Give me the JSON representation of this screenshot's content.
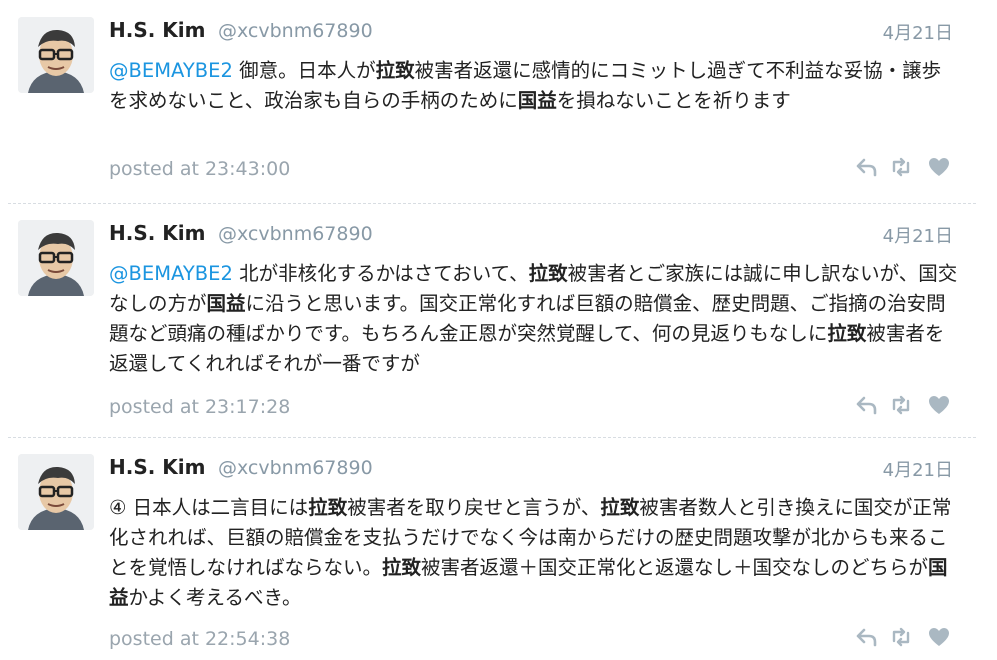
{
  "tweets": [
    {
      "name": "H.S. Kim",
      "handle": "@xcvbnm67890",
      "date": "4月21日",
      "segments": [
        {
          "t": "@BEMAYBE2",
          "s": "mention"
        },
        {
          "t": " 御意。日本人が",
          "s": ""
        },
        {
          "t": "拉致",
          "s": "bold"
        },
        {
          "t": "被害者返還に感情的にコミットし過ぎて不利益な妥協・譲歩を求めないこと、政治家も自らの手柄のために",
          "s": ""
        },
        {
          "t": "国益",
          "s": "bold"
        },
        {
          "t": "を損ねないことを祈ります",
          "s": ""
        }
      ],
      "posted": "posted at 23:43:00"
    },
    {
      "name": "H.S. Kim",
      "handle": "@xcvbnm67890",
      "date": "4月21日",
      "segments": [
        {
          "t": "@BEMAYBE2",
          "s": "mention"
        },
        {
          "t": " 北が非核化するかはさておいて、",
          "s": ""
        },
        {
          "t": "拉致",
          "s": "bold"
        },
        {
          "t": "被害者とご家族には誠に申し訳ないが、国交なしの方が",
          "s": ""
        },
        {
          "t": "国益",
          "s": "bold"
        },
        {
          "t": "に沿うと思います。国交正常化すれば巨額の賠償金、歴史問題、ご指摘の治安問題など頭痛の種ばかりです。もちろん金正恩が突然覚醒して、何の見返りもなしに",
          "s": ""
        },
        {
          "t": "拉致",
          "s": "bold"
        },
        {
          "t": "被害者を返還してくれればそれが一番ですが",
          "s": ""
        }
      ],
      "posted": "posted at 23:17:28"
    },
    {
      "name": "H.S. Kim",
      "handle": "@xcvbnm67890",
      "date": "4月21日",
      "segments": [
        {
          "t": "④ 日本人は二言目には",
          "s": ""
        },
        {
          "t": "拉致",
          "s": "bold"
        },
        {
          "t": "被害者を取り戻せと言うが、",
          "s": ""
        },
        {
          "t": "拉致",
          "s": "bold"
        },
        {
          "t": "被害者数人と引き換えに国交が正常化されれば、巨額の賠償金を支払うだけでなく今は南からだけの歴史問題攻撃が北からも来ることを覚悟しなければならない。",
          "s": ""
        },
        {
          "t": "拉致",
          "s": "bold"
        },
        {
          "t": "被害者返還＋国交正常化と返還なし＋国交なしのどちらが",
          "s": ""
        },
        {
          "t": "国益",
          "s": "bold"
        },
        {
          "t": "かよく考えるべき。",
          "s": ""
        }
      ],
      "posted": "posted at 22:54:38"
    }
  ],
  "icons": {
    "avatar": "avatar-image",
    "reply": "reply-icon",
    "retweet": "retweet-icon",
    "like": "heart-icon"
  },
  "colors": {
    "mention": "#1b95e0",
    "muted": "#8899a6",
    "action_icon": "#aab8c2",
    "divider": "#d8dde2"
  }
}
